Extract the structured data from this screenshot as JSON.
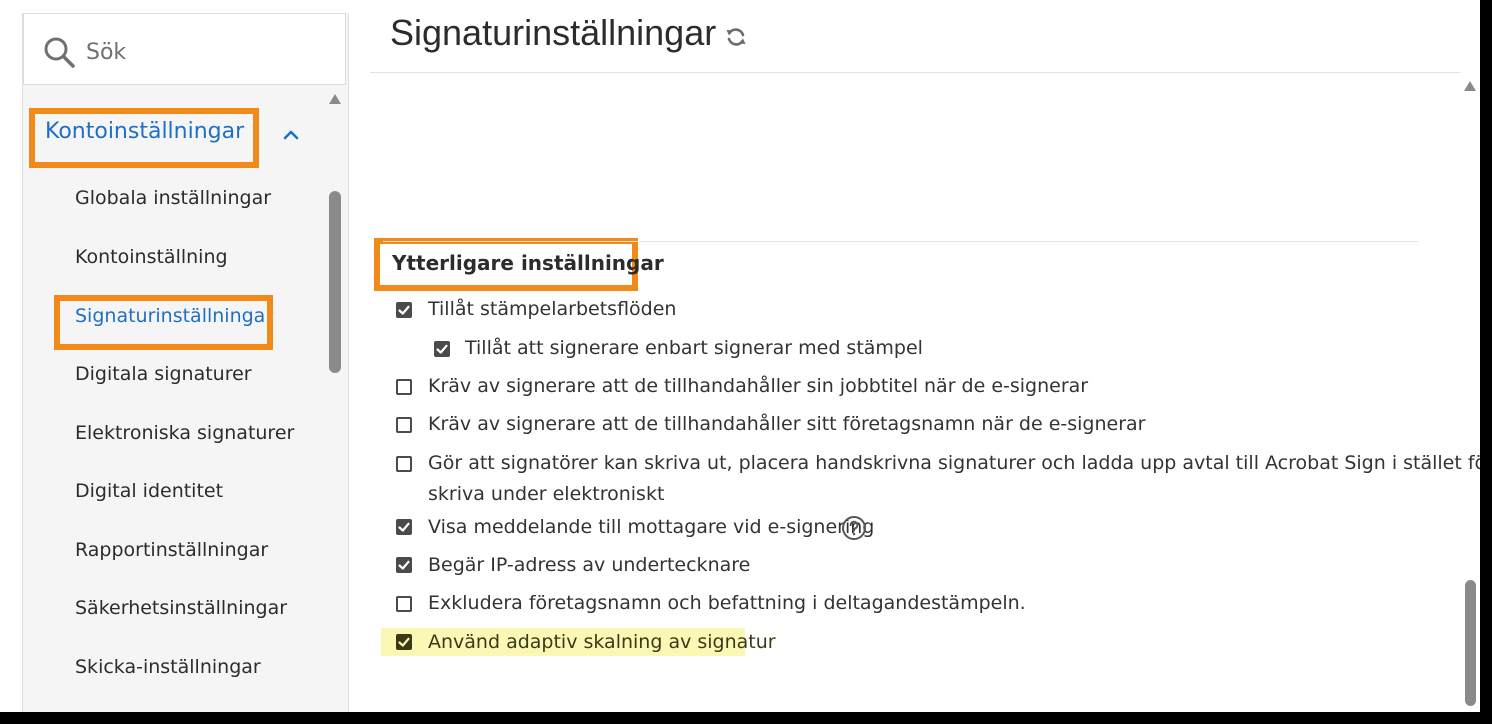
{
  "search": {
    "placeholder": "Sök"
  },
  "sidebar": {
    "section_title": "Kontoinställningar",
    "items": [
      {
        "label": "Globala inställningar"
      },
      {
        "label": "Kontoinställning"
      },
      {
        "label": "Signaturinställningar"
      },
      {
        "label": "Digitala signaturer"
      },
      {
        "label": "Elektroniska signaturer"
      },
      {
        "label": "Digital identitet"
      },
      {
        "label": "Rapportinställningar"
      },
      {
        "label": "Säkerhetsinställningar"
      },
      {
        "label": "Skicka-inställningar"
      }
    ],
    "active_item": "Signaturinställningar"
  },
  "main": {
    "title": "Signaturinställningar",
    "section_title": "Ytterligare inställningar",
    "options": [
      {
        "label": "Tillåt stämpelarbetsflöden",
        "checked": true
      },
      {
        "label": "Tillåt att signerare enbart signerar med stämpel",
        "checked": true
      },
      {
        "label": "Kräv av signerare att de tillhandahåller sin jobbtitel när de e-signerar",
        "checked": false
      },
      {
        "label": "Kräv av signerare att de tillhandahåller sitt företagsnamn när de e-signerar",
        "checked": false
      },
      {
        "label": "Gör att signatörer kan skriva ut, placera handskrivna signaturer och ladda upp avtal till Acrobat Sign i stället för att",
        "label_line2": "skriva under elektroniskt",
        "checked": false
      },
      {
        "label": "Visa meddelande till mottagare vid e-signering",
        "checked": true
      },
      {
        "label": "Begär IP-adress av undertecknare",
        "checked": true
      },
      {
        "label": "Exkludera företagsnamn och befattning i deltagandestämpeln.",
        "checked": false
      },
      {
        "label": "Använd adaptiv skalning av signatur",
        "checked": true
      }
    ]
  },
  "colors": {
    "accent_blue": "#1f6fc7",
    "highlight_orange": "#f28a1a",
    "highlight_yellow": "#fbf8b6"
  }
}
